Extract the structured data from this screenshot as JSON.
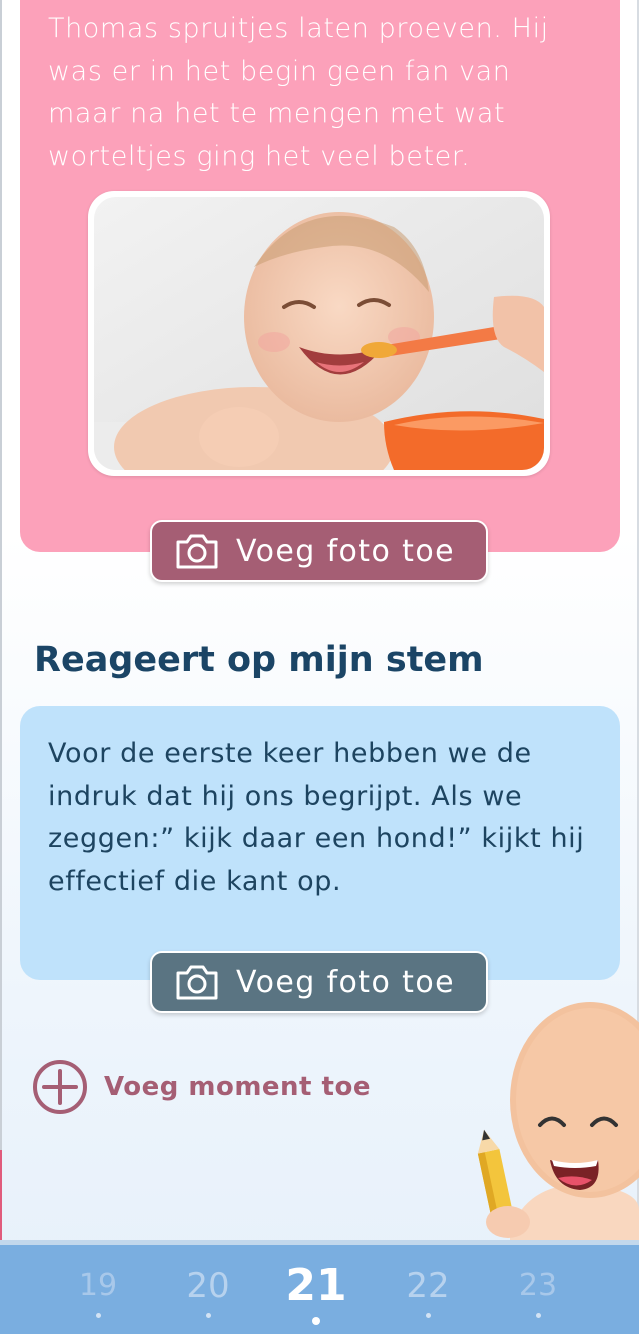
{
  "entries": [
    {
      "text": "Thomas spruitjes laten proeven. Hij was er in het begin geen fan van maar na het te mengen met wat worteltjes ging het veel beter.",
      "button_label": "Voeg foto toe",
      "color": "#fca1ba"
    },
    {
      "title": "Reageert op mijn stem",
      "text": "Voor de eerste keer hebben we de indruk dat hij ons begrijpt. Als we zeggen:” kijk daar een hond!” kijkt hij effectief die kant op.",
      "button_label": "Voeg foto toe",
      "color": "#bfe2fb"
    }
  ],
  "add_moment_label": "Voeg moment toe",
  "day_nav": {
    "days": [
      "19",
      "20",
      "21",
      "22",
      "23"
    ],
    "active": "21"
  },
  "colors": {
    "title": "#1b4566",
    "accent": "#a55e74",
    "bar": "#7aaee0"
  },
  "icons": [
    "camera-icon",
    "plus-circle-icon",
    "baby-mascot-icon"
  ]
}
